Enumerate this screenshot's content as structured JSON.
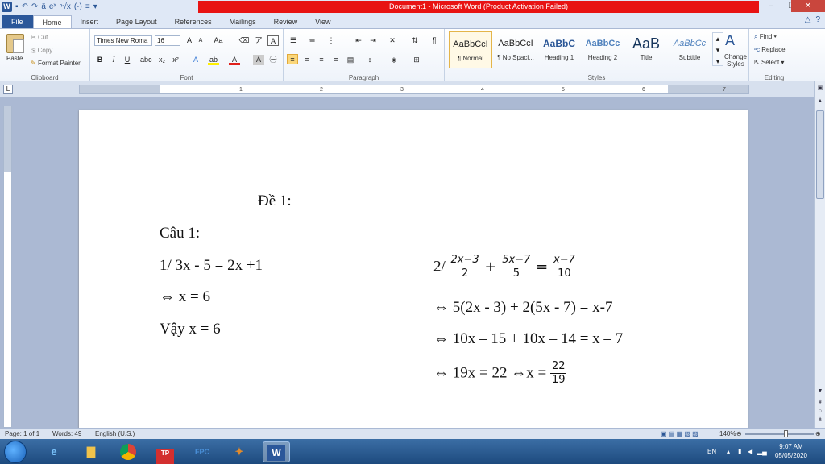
{
  "window": {
    "title": "Document1 - Microsoft Word (Product Activation Failed)",
    "qat_icons": [
      "word-icon",
      "save-icon",
      "undo-icon",
      "redo-icon"
    ],
    "qat_symbols": [
      "ä",
      "eˣ",
      "ⁿ√x",
      "(·)",
      "≡",
      "▾"
    ]
  },
  "tabs": [
    "File",
    "Home",
    "Insert",
    "Page Layout",
    "References",
    "Mailings",
    "Review",
    "View"
  ],
  "ribbon": {
    "clipboard": {
      "paste": "Paste",
      "cut": "Cut",
      "copy": "Copy",
      "format_painter": "Format Painter",
      "label": "Clipboard"
    },
    "font": {
      "name": "Times New Roma",
      "size": "16",
      "label": "Font"
    },
    "paragraph": {
      "label": "Paragraph"
    },
    "styles": {
      "label": "Styles",
      "items": [
        {
          "sample": "AaBbCcI",
          "name": "¶ Normal"
        },
        {
          "sample": "AaBbCcI",
          "name": "¶ No Spaci..."
        },
        {
          "sample": "AaBbC",
          "name": "Heading 1"
        },
        {
          "sample": "AaBbCc",
          "name": "Heading 2"
        },
        {
          "sample": "AaB",
          "name": "Title"
        },
        {
          "sample": "AaBbCc",
          "name": "Subtitle"
        }
      ],
      "change_styles": "Change Styles"
    },
    "editing": {
      "find": "Find",
      "replace": "Replace",
      "select": "Select",
      "label": "Editing"
    }
  },
  "ruler": {
    "ticks": [
      "1",
      "2",
      "3",
      "4",
      "5",
      "6",
      "7"
    ]
  },
  "document": {
    "heading": "Đề 1:",
    "question": "Câu 1:",
    "p1_equation": "1/ 3x - 5 = 2x +1",
    "p1_step": "⇔ x = 6",
    "p1_answer": "Vậy x = 6",
    "p2_prefix": "2/",
    "p2_frac1_num": "2x−3",
    "p2_frac1_den": "2",
    "p2_plus": "+",
    "p2_frac2_num": "5x−7",
    "p2_frac2_den": "5",
    "p2_eq": "=",
    "p2_frac3_num": "x−7",
    "p2_frac3_den": "10",
    "p2_step1": "⇔ 5(2x - 3) + 2(5x - 7) = x-7",
    "p2_step2": "⇔ 10x – 15 + 10x – 14 = x – 7",
    "p2_step3": "⇔ 19x = 22 ⇔x =",
    "p2_result_num": "22",
    "p2_result_den": "19"
  },
  "status": {
    "page": "Page: 1 of 1",
    "words": "Words: 49",
    "language": "English (U.S.)",
    "zoom": "140%"
  },
  "taskbar": {
    "apps": [
      "ie-icon",
      "explorer-icon",
      "chrome-icon",
      "tp-icon",
      "fpc-icon",
      "app-icon",
      "word-icon"
    ],
    "tp_label": "TP",
    "fpc_label": "FPC",
    "word_label": "W",
    "lang": "EN",
    "time": "9:07 AM",
    "date": "05/05/2020"
  }
}
